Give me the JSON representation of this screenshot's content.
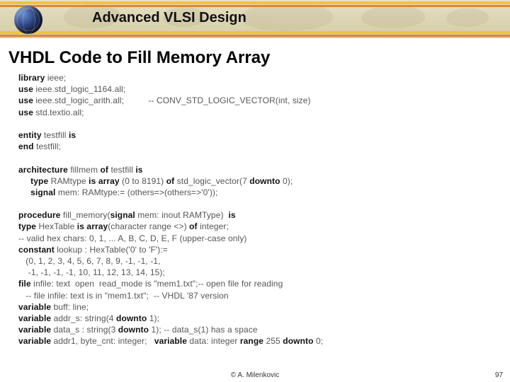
{
  "banner": {
    "course_title": "Advanced VLSI Design"
  },
  "slide": {
    "title": "VHDL Code to Fill Memory Array"
  },
  "code": {
    "l01a": "library",
    "l01b": " ieee;",
    "l02a": "use",
    "l02b": " ieee.std_logic_1164.all;",
    "l03a": "use",
    "l03b": " ieee.std_logic_arith.all;          -- CONV_STD_LOGIC_VECTOR(int, size)",
    "l04a": "use",
    "l04b": " std.textio.all;",
    "blank1": "",
    "l05a": "entity",
    "l05b": " testfill ",
    "l05c": "is",
    "l06a": "end",
    "l06b": " testfill;",
    "blank2": "",
    "l07a": "architecture",
    "l07b": " fillmem ",
    "l07c": "of",
    "l07d": " testfill ",
    "l07e": "is",
    "l08a": "     type",
    "l08b": " RAMtype ",
    "l08c": "is array",
    "l08d": " (0 to 8191) ",
    "l08e": "of",
    "l08f": " std_logic_vector(7 ",
    "l08g": "downto",
    "l08h": " 0);",
    "l09a": "     signal",
    "l09b": " mem: RAMtype:= (others=>(others=>'0'));",
    "blank3": "",
    "l10a": "procedure",
    "l10b": " fill_memory(",
    "l10c": "signal",
    "l10d": " mem: inout RAMType)  ",
    "l10e": "is",
    "l11a": "type",
    "l11b": " HexTable ",
    "l11c": "is array",
    "l11d": "(character range <>) ",
    "l11e": "of",
    "l11f": " integer;",
    "l12": "-- valid hex chars: 0, 1, ... A, B, C, D, E, F (upper-case only)",
    "l13a": "constant",
    "l13b": " lookup : HexTable('0' to 'F'):=",
    "l14": "   (0, 1, 2, 3, 4, 5, 6, 7, 8, 9, -1, -1, -1,",
    "l15": "    -1, -1, -1, -1, 10, 11, 12, 13, 14, 15);",
    "l16a": "file",
    "l16b": " infile: text  open  read_mode is \"mem1.txt\";-- open file for reading",
    "l17": "   -- file infile: text is in \"mem1.txt\";  -- VHDL '87 version",
    "l18a": "variable",
    "l18b": " buff: line;",
    "l19a": "variable",
    "l19b": " addr_s: string(4 ",
    "l19c": "downto",
    "l19d": " 1);",
    "l20a": "variable",
    "l20b": " data_s : string(3 ",
    "l20c": "downto",
    "l20d": " 1); -- data_s(1) has a space",
    "l21a": "variable",
    "l21b": " addr1, byte_cnt: integer;   ",
    "l21c": "variable",
    "l21d": " data: integer ",
    "l21e": "range",
    "l21f": " 255 ",
    "l21g": "downto",
    "l21h": " 0;"
  },
  "footer": {
    "author": "©  A. Milenkovic",
    "page": "97"
  }
}
